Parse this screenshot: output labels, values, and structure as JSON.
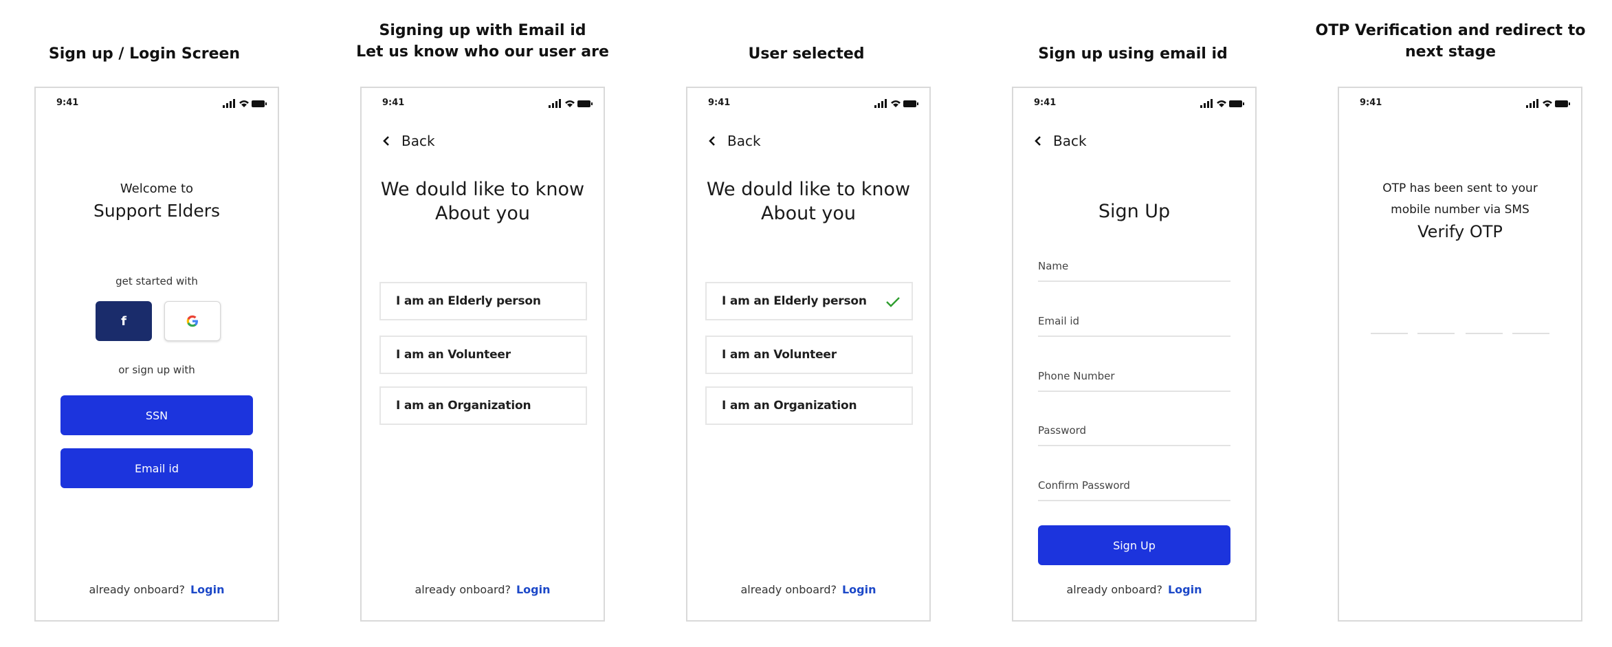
{
  "captions": {
    "s1": [
      "Sign up / Login Screen"
    ],
    "s2": [
      "Signing up with Email id",
      "Let us know who our user are"
    ],
    "s3": [
      "User selected"
    ],
    "s4": [
      "Sign up using email id"
    ],
    "s5": [
      "OTP Verification and redirect to",
      "next stage"
    ]
  },
  "status": {
    "time": "9:41"
  },
  "back_label": "Back",
  "footer": {
    "text": "already onboard?",
    "login": "Login"
  },
  "screen1": {
    "welcome": "Welcome to",
    "app_name": "Support Elders",
    "get_started": "get started with",
    "facebook": "f",
    "google": "G",
    "or_signup": "or sign up with",
    "ssn": "SSN",
    "email": "Email id"
  },
  "about": {
    "title_line1": "We dould like to know",
    "title_line2": "About you",
    "options": [
      "I am an Elderly person",
      "I am an Volunteer",
      "I am an Organization"
    ]
  },
  "signup": {
    "title": "Sign Up",
    "fields": [
      "Name",
      "Email id",
      "Phone Number",
      "Password",
      "Confirm Password"
    ],
    "button": "Sign Up"
  },
  "otp": {
    "line1": "OTP has been sent to your",
    "line2": "mobile number via SMS",
    "title": "Verify OTP"
  },
  "colors": {
    "primary": "#1c34dd",
    "facebook": "#1a2c6b",
    "link": "#1c48c8",
    "check": "#2f9e2f"
  }
}
